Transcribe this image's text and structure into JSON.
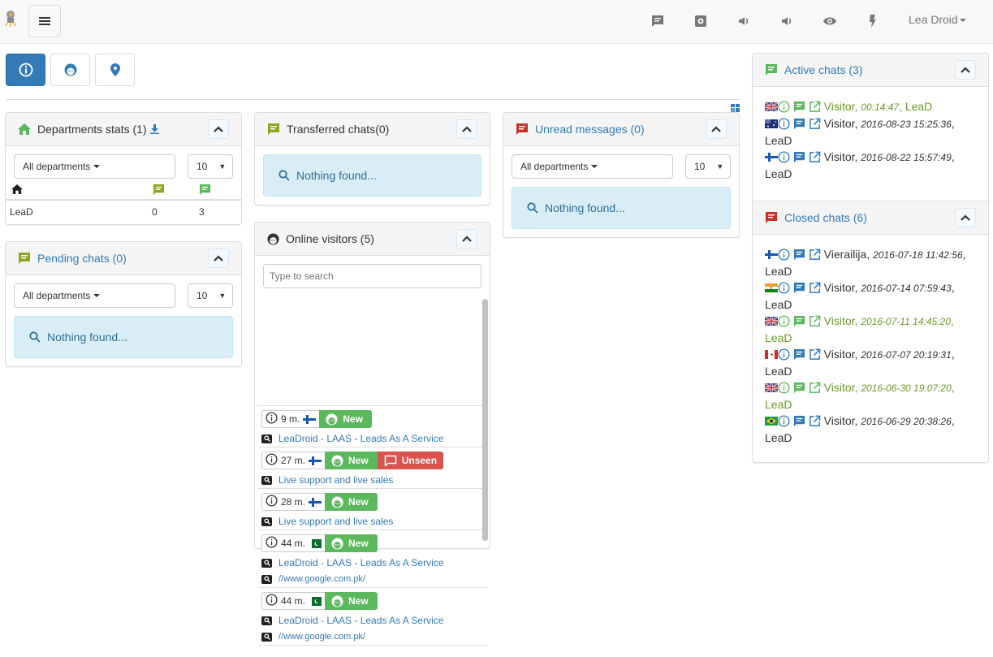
{
  "header": {
    "user_name": "Lea Droid",
    "nav_icons": [
      "chat-icon",
      "settings-icon",
      "sound-icon",
      "sound-icon-2",
      "eye-icon",
      "bolt-icon"
    ]
  },
  "tabs": [
    {
      "name": "info-tab",
      "icon": "info-icon",
      "active": true
    },
    {
      "name": "visitors-tab",
      "icon": "face-icon",
      "active": false
    },
    {
      "name": "map-tab",
      "icon": "map-marker-icon",
      "active": false
    }
  ],
  "colors": {
    "primary": "#337ab7",
    "success": "#5cb85c",
    "danger": "#d9534f",
    "olive": "#8ea51f",
    "red_icon": "#c9302c"
  },
  "departments_stats": {
    "title": "Departments stats (1)",
    "department_select": "All departments",
    "limit_select": "10",
    "rows": [
      {
        "name": "LeaD",
        "pending": "0",
        "active": "3"
      }
    ]
  },
  "pending_chats": {
    "title": "Pending chats (0)",
    "department_select": "All departments",
    "limit_select": "10",
    "empty_text": "Nothing found..."
  },
  "transferred_chats": {
    "title": "Transferred chats(0)",
    "empty_text": "Nothing found..."
  },
  "online_visitors": {
    "title": "Online visitors (5)",
    "search_placeholder": "Type to search",
    "visitors": [
      {
        "time": "9 m.",
        "flag": "fi",
        "status": "New",
        "unseen": "",
        "pages": [
          "LeaDroid - LAAS - Leads As A Service"
        ]
      },
      {
        "time": "27 m.",
        "flag": "fi",
        "status": "New",
        "unseen": "Unseen",
        "pages": [
          "Live support and live sales"
        ]
      },
      {
        "time": "28 m.",
        "flag": "fi",
        "status": "New",
        "unseen": "",
        "pages": [
          "Live support and live sales"
        ]
      },
      {
        "time": "44 m.",
        "flag": "pk",
        "status": "New",
        "unseen": "",
        "pages": [
          "LeaDroid - LAAS - Leads As A Service",
          "//www.google.com.pk/"
        ]
      },
      {
        "time": "44 m.",
        "flag": "pk",
        "status": "New",
        "unseen": "",
        "pages": [
          "LeaDroid - LAAS - Leads As A Service",
          "//www.google.com.pk/"
        ]
      }
    ]
  },
  "unread_messages": {
    "title": "Unread messages (0)",
    "department_select": "All departments",
    "limit_select": "10",
    "empty_text": "Nothing found..."
  },
  "active_chats": {
    "title": "Active chats (3)",
    "chats": [
      {
        "flag": "gb",
        "name": "Visitor",
        "sep": ", ",
        "time": "00:14:47",
        "user": "LeaD",
        "highlight": true
      },
      {
        "flag": "au",
        "name": "Visitor",
        "sep": ", ",
        "time": "2016-08-23 15:25:36",
        "user": "LeaD",
        "highlight": false
      },
      {
        "flag": "fi",
        "name": "Visitor",
        "sep": ", ",
        "time": "2016-08-22 15:57:49",
        "user": "LeaD",
        "highlight": false
      }
    ]
  },
  "closed_chats": {
    "title": "Closed chats (6)",
    "chats": [
      {
        "flag": "fi",
        "name": "Vierailija",
        "sep": ", ",
        "time": "2016-07-18 11:42:56",
        "user": "LeaD",
        "highlight": false
      },
      {
        "flag": "in",
        "name": "Visitor",
        "sep": ", ",
        "time": "2016-07-14 07:59:43",
        "user": "LeaD",
        "highlight": false
      },
      {
        "flag": "gb",
        "name": "Visitor",
        "sep": ", ",
        "time": "2016-07-11 14:45:20",
        "user": "LeaD",
        "highlight": true
      },
      {
        "flag": "ca",
        "name": "Visitor",
        "sep": ", ",
        "time": "2016-07-07 20:19:31",
        "user": "LeaD",
        "highlight": false
      },
      {
        "flag": "gb",
        "name": "Visitor",
        "sep": ", ",
        "time": "2016-06-30 19:07:20",
        "user": "LeaD",
        "highlight": true
      },
      {
        "flag": "br",
        "name": "Visitor",
        "sep": ", ",
        "time": "2016-06-29 20:38:26",
        "user": "LeaD",
        "highlight": false
      }
    ]
  }
}
